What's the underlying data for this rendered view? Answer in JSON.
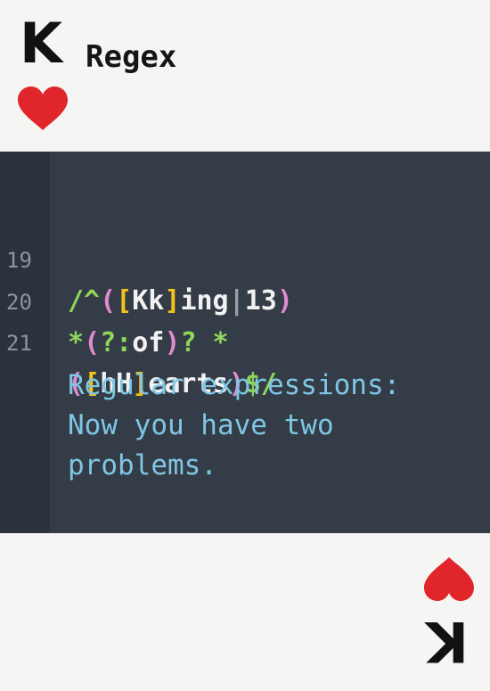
{
  "card": {
    "rank": "K",
    "title": "Regex",
    "suit_icon": "heart-icon",
    "suit_color": "#e0252b"
  },
  "code": {
    "lines": [
      {
        "number": "19",
        "tokens": [
          {
            "text": "/^",
            "color": "green"
          },
          {
            "text": "(",
            "color": "pink"
          },
          {
            "text": "[",
            "color": "yellow"
          },
          {
            "text": "Kk",
            "color": "white"
          },
          {
            "text": "]",
            "color": "yellow"
          },
          {
            "text": "ing",
            "color": "white"
          },
          {
            "text": "|",
            "color": "grey"
          },
          {
            "text": "13",
            "color": "white"
          },
          {
            "text": ")",
            "color": "pink"
          }
        ]
      },
      {
        "number": "20",
        "tokens": [
          {
            "text": "*",
            "color": "green"
          },
          {
            "text": "(",
            "color": "pink"
          },
          {
            "text": "?:",
            "color": "green"
          },
          {
            "text": "of",
            "color": "white"
          },
          {
            "text": ")",
            "color": "pink"
          },
          {
            "text": "? *",
            "color": "green"
          }
        ]
      },
      {
        "number": "21",
        "tokens": [
          {
            "text": "(",
            "color": "pink"
          },
          {
            "text": "[",
            "color": "yellow"
          },
          {
            "text": "hH",
            "color": "white"
          },
          {
            "text": "]",
            "color": "yellow"
          },
          {
            "text": "earts",
            "color": "white"
          },
          {
            "text": ")",
            "color": "pink"
          },
          {
            "text": "$/",
            "color": "green"
          }
        ]
      }
    ],
    "comment": [
      "Regular expressions:",
      "Now you have two",
      "problems."
    ],
    "colors": {
      "background": "#343c47",
      "gutter": "#2b323b",
      "green": "#8fd65a",
      "pink": "#e08ad0",
      "yellow": "#f2c318",
      "white": "#f2f2f2",
      "comment": "#7fc6e4"
    }
  }
}
